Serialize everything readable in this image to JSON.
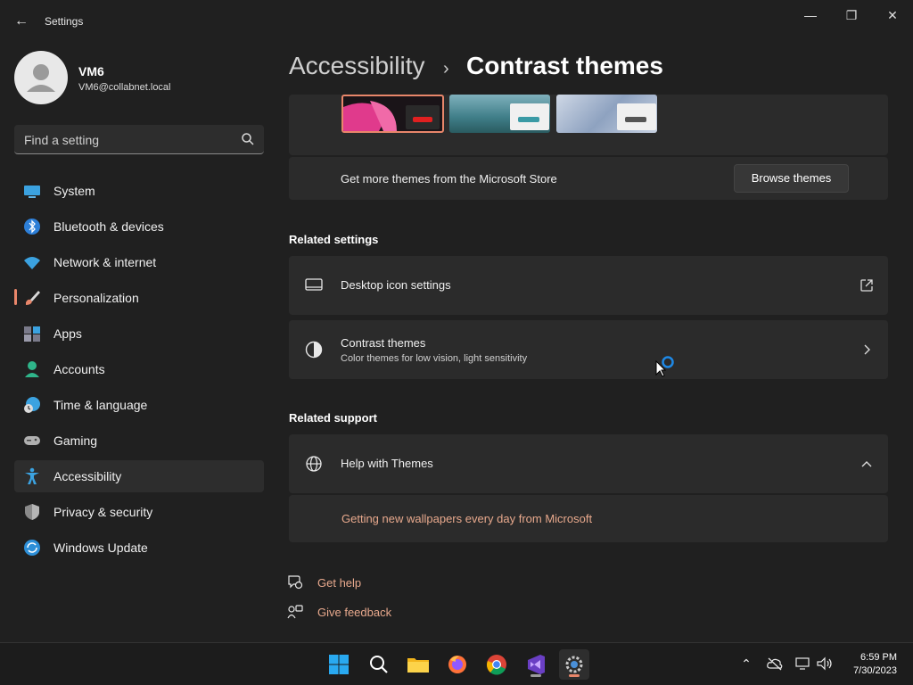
{
  "window": {
    "title": "Settings",
    "back_icon": "arrow-left-icon",
    "controls": [
      "minimize",
      "maximize",
      "close"
    ]
  },
  "user": {
    "name": "VM6",
    "email": "VM6@collabnet.local"
  },
  "search": {
    "placeholder": "Find a setting"
  },
  "nav": [
    {
      "label": "System",
      "icon": "monitor-icon"
    },
    {
      "label": "Bluetooth & devices",
      "icon": "bluetooth-icon"
    },
    {
      "label": "Network & internet",
      "icon": "wifi-icon"
    },
    {
      "label": "Personalization",
      "icon": "brush-icon"
    },
    {
      "label": "Apps",
      "icon": "apps-icon"
    },
    {
      "label": "Accounts",
      "icon": "person-icon"
    },
    {
      "label": "Time & language",
      "icon": "clock-globe-icon"
    },
    {
      "label": "Gaming",
      "icon": "gamepad-icon"
    },
    {
      "label": "Accessibility",
      "icon": "accessibility-icon",
      "selected": true
    },
    {
      "label": "Privacy & security",
      "icon": "shield-icon"
    },
    {
      "label": "Windows Update",
      "icon": "update-icon"
    }
  ],
  "breadcrumb": {
    "parent": "Accessibility",
    "separator": "›",
    "current": "Contrast themes"
  },
  "themes_card": {
    "store_text": "Get more themes from the Microsoft Store",
    "browse_button": "Browse themes"
  },
  "related_settings": {
    "heading": "Related settings",
    "items": [
      {
        "title": "Desktop icon settings",
        "icon": "desktop-icon",
        "action_icon": "external-link-icon"
      },
      {
        "title": "Contrast themes",
        "subtitle": "Color themes for low vision, light sensitivity",
        "icon": "contrast-icon",
        "action_icon": "chevron-right-icon"
      }
    ]
  },
  "related_support": {
    "heading": "Related support",
    "help_title": "Help with Themes",
    "help_icon": "globe-icon",
    "expand_icon": "chevron-up-icon",
    "link": "Getting new wallpapers every day from Microsoft"
  },
  "footer_links": [
    {
      "label": "Get help",
      "icon": "help-chat-icon"
    },
    {
      "label": "Give feedback",
      "icon": "feedback-icon"
    }
  ],
  "taskbar": {
    "apps": [
      "windows-start-icon",
      "search-icon",
      "file-explorer-icon",
      "firefox-icon",
      "chrome-icon",
      "visual-studio-icon",
      "settings-gear-icon"
    ],
    "tray": [
      "chevron-up-icon",
      "cloud-offline-icon",
      "network-icon",
      "volume-icon"
    ],
    "time": "6:59 PM",
    "date": "7/30/2023"
  },
  "colors": {
    "accent": "#e8866a",
    "link": "#e8a98d",
    "background": "#202020",
    "card": "#2b2b2b"
  }
}
